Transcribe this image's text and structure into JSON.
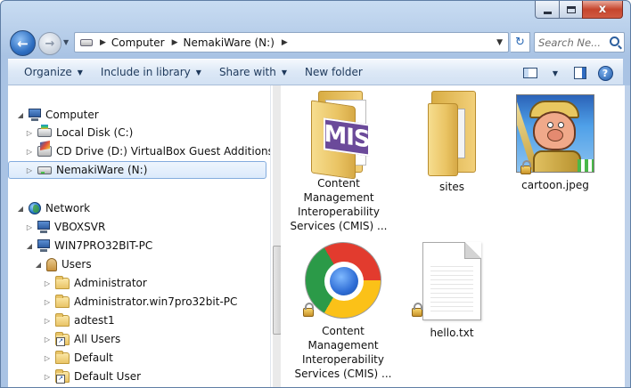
{
  "window": {
    "close_symbol": "x"
  },
  "nav": {
    "breadcrumbs": [
      "Computer",
      "NemakiWare (N:)"
    ],
    "search_placeholder": "Search Ne..."
  },
  "toolbar": {
    "organize": "Organize",
    "include_in_library": "Include in library",
    "share_with": "Share with",
    "new_folder": "New folder",
    "help": "?"
  },
  "tree": {
    "computer": "Computer",
    "local_disk": "Local Disk (C:)",
    "cd_drive": "CD Drive (D:) VirtualBox Guest Additions",
    "nemakiware": "NemakiWare (N:)",
    "network": "Network",
    "vboxsvr": "VBOXSVR",
    "win7": "WIN7PRO32BIT-PC",
    "users": "Users",
    "administrator": "Administrator",
    "administrator_pc": "Administrator.win7pro32bit-PC",
    "adtest1": "adtest1",
    "all_users": "All Users",
    "default": "Default",
    "default_user": "Default User"
  },
  "items": {
    "cmis_folder": [
      "Content",
      "Management",
      "Interoperability",
      "Services (CMIS) ..."
    ],
    "sites": "sites",
    "cartoon": "cartoon.jpeg",
    "cmis_chrome": [
      "Content",
      "Management",
      "Interoperability",
      "Services (CMIS) ..."
    ],
    "hello": "hello.txt",
    "cmis_badge_text": "MIS"
  }
}
